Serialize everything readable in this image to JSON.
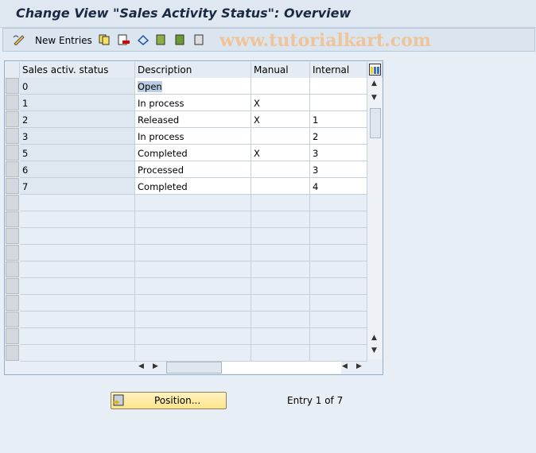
{
  "title": "Change View \"Sales Activity Status\": Overview",
  "toolbar": {
    "new_entries": "New Entries",
    "icons": [
      "edit-pencil-icon",
      "copy-icon",
      "delete-icon",
      "undo-icon",
      "select-all-icon",
      "select-block-icon",
      "deselect-all-icon"
    ],
    "watermark": "www.tutorialkart.com"
  },
  "table": {
    "columns": [
      "Sales activ. status",
      "Description",
      "Manual",
      "Internal"
    ],
    "rows": [
      {
        "status": "0",
        "description": "Open",
        "manual": "",
        "internal": ""
      },
      {
        "status": "1",
        "description": "In process",
        "manual": "X",
        "internal": ""
      },
      {
        "status": "2",
        "description": "Released",
        "manual": "X",
        "internal": "1"
      },
      {
        "status": "3",
        "description": "In process",
        "manual": "",
        "internal": "2"
      },
      {
        "status": "5",
        "description": "Completed",
        "manual": "X",
        "internal": "3"
      },
      {
        "status": "6",
        "description": "Processed",
        "manual": "",
        "internal": "3"
      },
      {
        "status": "7",
        "description": "Completed",
        "manual": "",
        "internal": "4"
      }
    ]
  },
  "footer": {
    "position_button": "Position...",
    "entry_text": "Entry 1 of 7"
  }
}
